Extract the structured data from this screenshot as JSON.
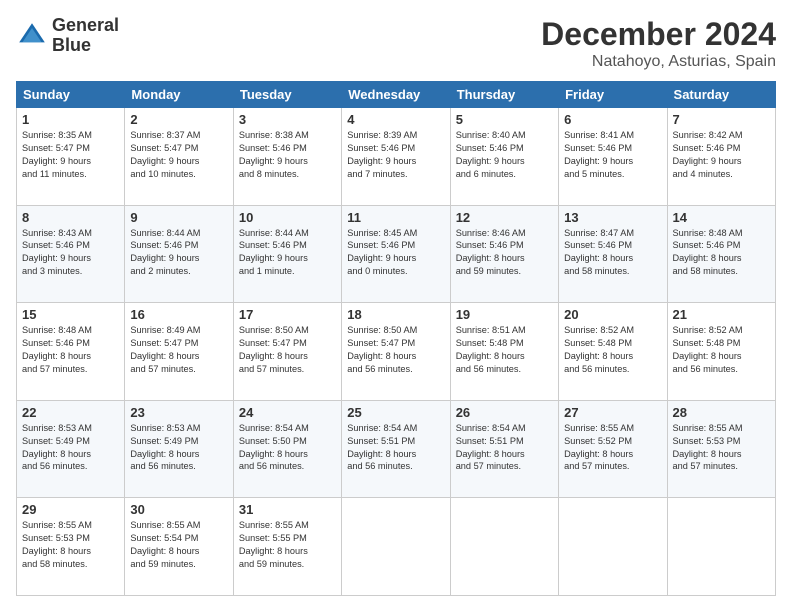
{
  "header": {
    "logo_line1": "General",
    "logo_line2": "Blue",
    "month": "December 2024",
    "location": "Natahoyo, Asturias, Spain"
  },
  "days_of_week": [
    "Sunday",
    "Monday",
    "Tuesday",
    "Wednesday",
    "Thursday",
    "Friday",
    "Saturday"
  ],
  "weeks": [
    [
      {
        "day": "1",
        "info": "Sunrise: 8:35 AM\nSunset: 5:47 PM\nDaylight: 9 hours\nand 11 minutes."
      },
      {
        "day": "2",
        "info": "Sunrise: 8:37 AM\nSunset: 5:47 PM\nDaylight: 9 hours\nand 10 minutes."
      },
      {
        "day": "3",
        "info": "Sunrise: 8:38 AM\nSunset: 5:46 PM\nDaylight: 9 hours\nand 8 minutes."
      },
      {
        "day": "4",
        "info": "Sunrise: 8:39 AM\nSunset: 5:46 PM\nDaylight: 9 hours\nand 7 minutes."
      },
      {
        "day": "5",
        "info": "Sunrise: 8:40 AM\nSunset: 5:46 PM\nDaylight: 9 hours\nand 6 minutes."
      },
      {
        "day": "6",
        "info": "Sunrise: 8:41 AM\nSunset: 5:46 PM\nDaylight: 9 hours\nand 5 minutes."
      },
      {
        "day": "7",
        "info": "Sunrise: 8:42 AM\nSunset: 5:46 PM\nDaylight: 9 hours\nand 4 minutes."
      }
    ],
    [
      {
        "day": "8",
        "info": "Sunrise: 8:43 AM\nSunset: 5:46 PM\nDaylight: 9 hours\nand 3 minutes."
      },
      {
        "day": "9",
        "info": "Sunrise: 8:44 AM\nSunset: 5:46 PM\nDaylight: 9 hours\nand 2 minutes."
      },
      {
        "day": "10",
        "info": "Sunrise: 8:44 AM\nSunset: 5:46 PM\nDaylight: 9 hours\nand 1 minute."
      },
      {
        "day": "11",
        "info": "Sunrise: 8:45 AM\nSunset: 5:46 PM\nDaylight: 9 hours\nand 0 minutes."
      },
      {
        "day": "12",
        "info": "Sunrise: 8:46 AM\nSunset: 5:46 PM\nDaylight: 8 hours\nand 59 minutes."
      },
      {
        "day": "13",
        "info": "Sunrise: 8:47 AM\nSunset: 5:46 PM\nDaylight: 8 hours\nand 58 minutes."
      },
      {
        "day": "14",
        "info": "Sunrise: 8:48 AM\nSunset: 5:46 PM\nDaylight: 8 hours\nand 58 minutes."
      }
    ],
    [
      {
        "day": "15",
        "info": "Sunrise: 8:48 AM\nSunset: 5:46 PM\nDaylight: 8 hours\nand 57 minutes."
      },
      {
        "day": "16",
        "info": "Sunrise: 8:49 AM\nSunset: 5:47 PM\nDaylight: 8 hours\nand 57 minutes."
      },
      {
        "day": "17",
        "info": "Sunrise: 8:50 AM\nSunset: 5:47 PM\nDaylight: 8 hours\nand 57 minutes."
      },
      {
        "day": "18",
        "info": "Sunrise: 8:50 AM\nSunset: 5:47 PM\nDaylight: 8 hours\nand 56 minutes."
      },
      {
        "day": "19",
        "info": "Sunrise: 8:51 AM\nSunset: 5:48 PM\nDaylight: 8 hours\nand 56 minutes."
      },
      {
        "day": "20",
        "info": "Sunrise: 8:52 AM\nSunset: 5:48 PM\nDaylight: 8 hours\nand 56 minutes."
      },
      {
        "day": "21",
        "info": "Sunrise: 8:52 AM\nSunset: 5:48 PM\nDaylight: 8 hours\nand 56 minutes."
      }
    ],
    [
      {
        "day": "22",
        "info": "Sunrise: 8:53 AM\nSunset: 5:49 PM\nDaylight: 8 hours\nand 56 minutes."
      },
      {
        "day": "23",
        "info": "Sunrise: 8:53 AM\nSunset: 5:49 PM\nDaylight: 8 hours\nand 56 minutes."
      },
      {
        "day": "24",
        "info": "Sunrise: 8:54 AM\nSunset: 5:50 PM\nDaylight: 8 hours\nand 56 minutes."
      },
      {
        "day": "25",
        "info": "Sunrise: 8:54 AM\nSunset: 5:51 PM\nDaylight: 8 hours\nand 56 minutes."
      },
      {
        "day": "26",
        "info": "Sunrise: 8:54 AM\nSunset: 5:51 PM\nDaylight: 8 hours\nand 57 minutes."
      },
      {
        "day": "27",
        "info": "Sunrise: 8:55 AM\nSunset: 5:52 PM\nDaylight: 8 hours\nand 57 minutes."
      },
      {
        "day": "28",
        "info": "Sunrise: 8:55 AM\nSunset: 5:53 PM\nDaylight: 8 hours\nand 57 minutes."
      }
    ],
    [
      {
        "day": "29",
        "info": "Sunrise: 8:55 AM\nSunset: 5:53 PM\nDaylight: 8 hours\nand 58 minutes."
      },
      {
        "day": "30",
        "info": "Sunrise: 8:55 AM\nSunset: 5:54 PM\nDaylight: 8 hours\nand 59 minutes."
      },
      {
        "day": "31",
        "info": "Sunrise: 8:55 AM\nSunset: 5:55 PM\nDaylight: 8 hours\nand 59 minutes."
      },
      null,
      null,
      null,
      null
    ]
  ]
}
